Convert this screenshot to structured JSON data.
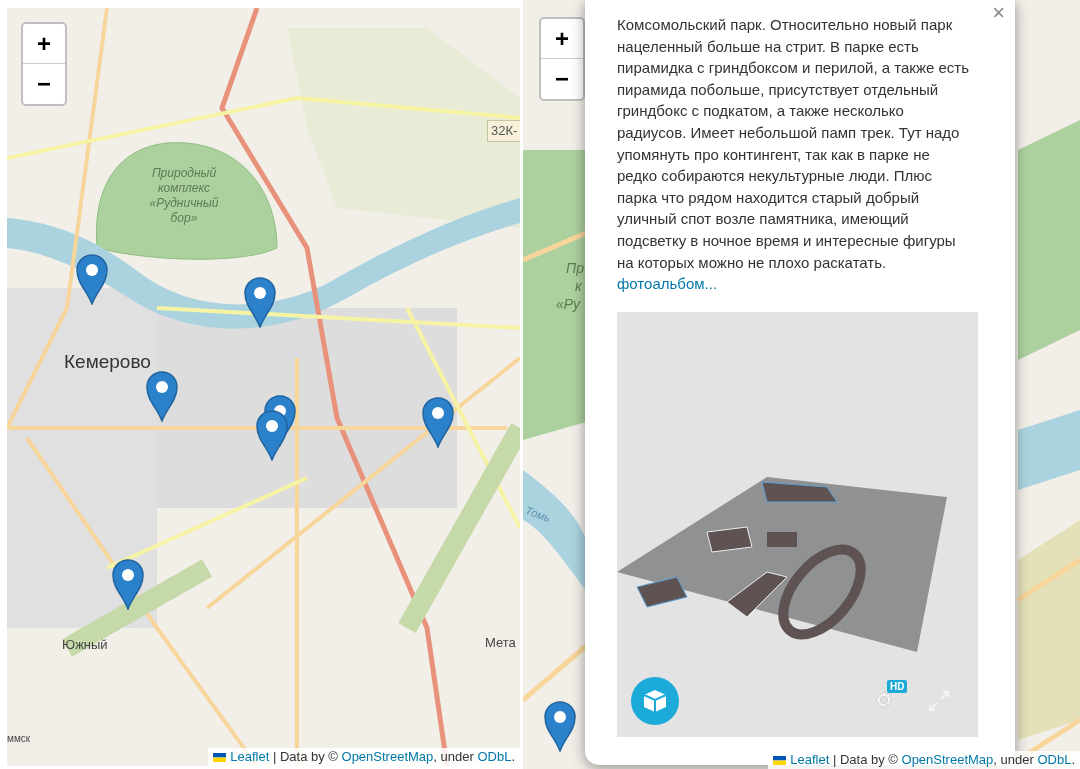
{
  "maps": [
    {
      "zoom_in": "+",
      "zoom_out": "−",
      "labels": [
        {
          "text": "Природный комплекс «Рудничный бор»"
        },
        {
          "text": "Кемерово"
        },
        {
          "text": "32К-"
        },
        {
          "text": "Южный"
        },
        {
          "text": "Мета"
        },
        {
          "text": "ммск"
        }
      ],
      "attribution": {
        "parts": [
          {
            "kind": "link",
            "text": "Leaflet"
          },
          {
            "kind": "text",
            "text": " | Data by © "
          },
          {
            "kind": "link",
            "text": "OpenStreetMap"
          },
          {
            "kind": "text",
            "text": ", under "
          },
          {
            "kind": "link",
            "text": "ODbL"
          },
          {
            "kind": "text",
            "text": "."
          }
        ]
      }
    },
    {
      "zoom_in": "+",
      "zoom_out": "−",
      "labels": [
        {
          "text": "Пр"
        },
        {
          "text": "к"
        },
        {
          "text": "«Ру"
        },
        {
          "text": "Томь"
        }
      ],
      "attribution": {
        "parts": [
          {
            "kind": "link",
            "text": "Leaflet"
          },
          {
            "kind": "text",
            "text": " | Data by © "
          },
          {
            "kind": "link",
            "text": "OpenStreetMap"
          },
          {
            "kind": "text",
            "text": ", under "
          },
          {
            "kind": "link",
            "text": "ODbL"
          },
          {
            "kind": "text",
            "text": "."
          }
        ]
      },
      "popup": {
        "close": "×",
        "text": "Комсомольский парк. Относительно новый парк нацеленный больше на стрит. В парке есть пирамидка с гриндбоксом и перилой, а также есть пирамида побольше, присутствует отдельный гриндбокс с подкатом, а также несколько радиусов. Имеет небольшой памп трек. Тут надо упомянуть про контингент, так как в парке не редко собираются некультурные люди. Плюс парка что рядом находится старый добрый уличный спот возле памятника, имеющий подсветку в ночное время и интересные фигуры на которых можно не плохо раскатать.",
        "link": "фотоальбом...",
        "viewer": {
          "badge": "HD"
        }
      }
    }
  ]
}
